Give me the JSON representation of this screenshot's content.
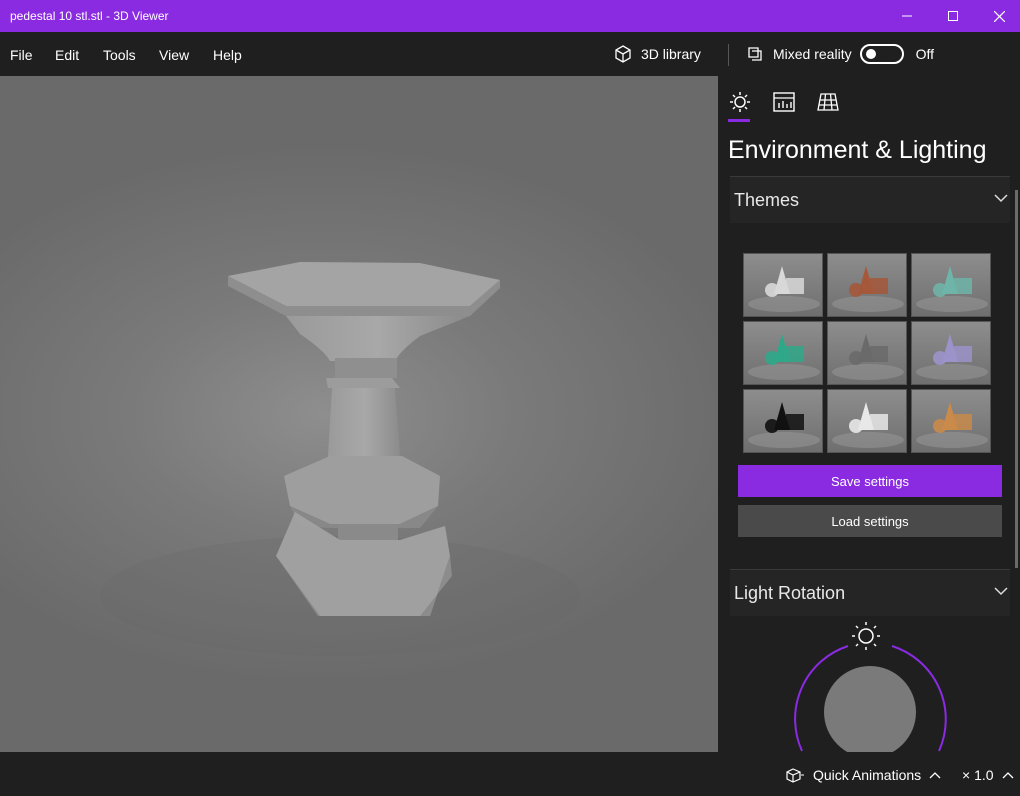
{
  "window": {
    "title": "pedestal 10 stl.stl - 3D Viewer"
  },
  "menu": {
    "file": "File",
    "edit": "Edit",
    "tools": "Tools",
    "view": "View",
    "help": "Help"
  },
  "toolbar": {
    "library_label": "3D library",
    "mixed_reality_label": "Mixed reality",
    "mixed_reality_state": "Off"
  },
  "panel": {
    "title": "Environment & Lighting",
    "themes": {
      "label": "Themes",
      "tiles": [
        {
          "name": "theme-white",
          "color": "#d8d8d8"
        },
        {
          "name": "theme-dark-orange",
          "color": "#a5583a"
        },
        {
          "name": "theme-teal",
          "color": "#6fb4a8"
        },
        {
          "name": "theme-green",
          "color": "#2fa88a"
        },
        {
          "name": "theme-gray",
          "color": "#6a6a6a"
        },
        {
          "name": "theme-lavender",
          "color": "#9b93c9"
        },
        {
          "name": "theme-black",
          "color": "#111111"
        },
        {
          "name": "theme-light",
          "color": "#e8e8e8"
        },
        {
          "name": "theme-multicolor",
          "color": "#c98a4a"
        }
      ]
    },
    "save_label": "Save settings",
    "load_label": "Load settings",
    "light_rotation_label": "Light Rotation"
  },
  "status": {
    "quick_animations_label": "Quick Animations",
    "speed_label": "× 1.0"
  },
  "colors": {
    "accent": "#8a2be2",
    "background": "#1f1f1f",
    "secondary_button": "#4a4a4a"
  }
}
